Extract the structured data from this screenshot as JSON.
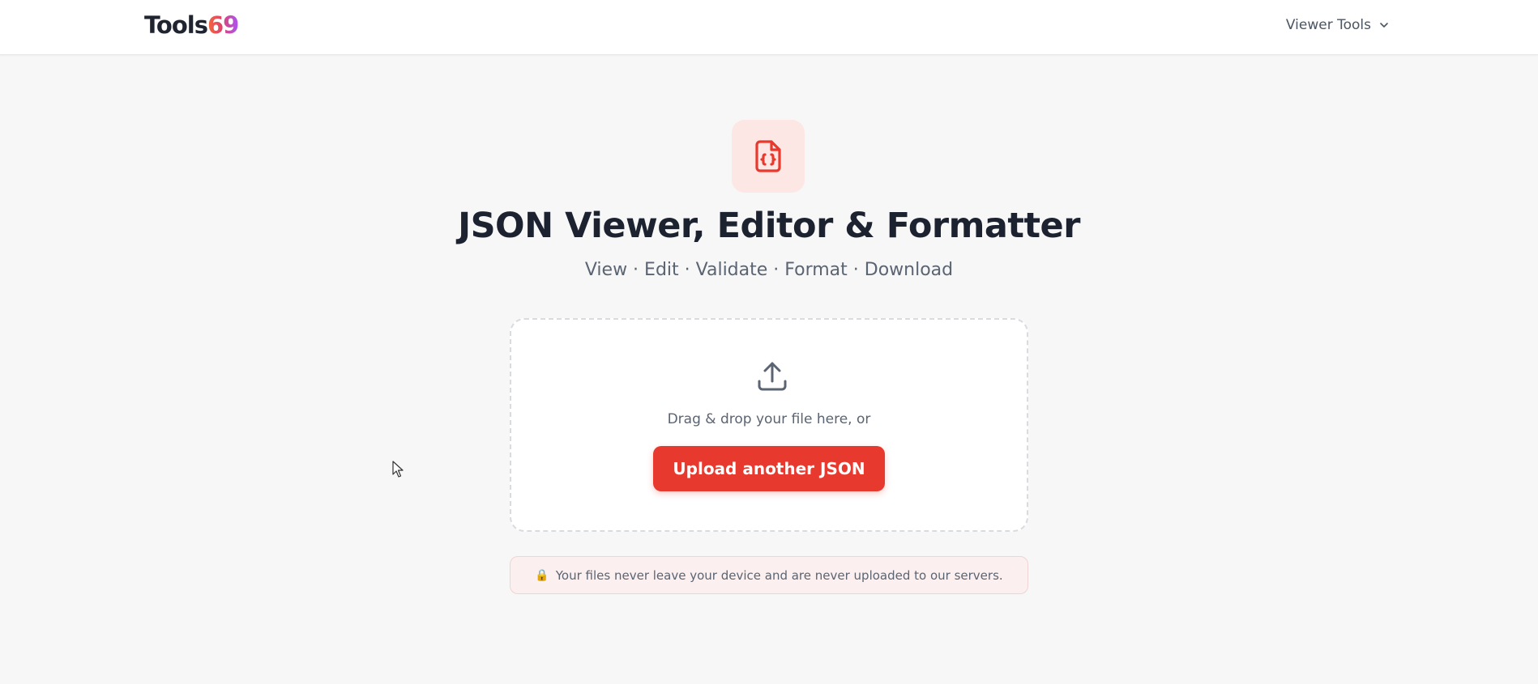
{
  "brand": {
    "name_prefix": "Tools",
    "name_suffix": "69",
    "gradient_colors": [
      "#f26b3a",
      "#e0446b",
      "#a855f7"
    ]
  },
  "nav": {
    "menu_label": "Viewer Tools",
    "menu_icon": "chevron-down-icon"
  },
  "hero": {
    "icon": "json-file-icon",
    "title": "JSON Viewer, Editor & Formatter",
    "subtitle": "View · Edit · Validate · Format · Download"
  },
  "dropzone": {
    "icon": "upload-icon",
    "text": "Drag & drop your file here, or",
    "button_label": "Upload another JSON"
  },
  "privacy": {
    "icon": "lock-icon",
    "text": "Your files never leave your device and are never uploaded to our servers."
  },
  "colors": {
    "accent": "#e8392f",
    "icon_bg": "#fde7e4",
    "page_bg": "#f7f7f7"
  }
}
